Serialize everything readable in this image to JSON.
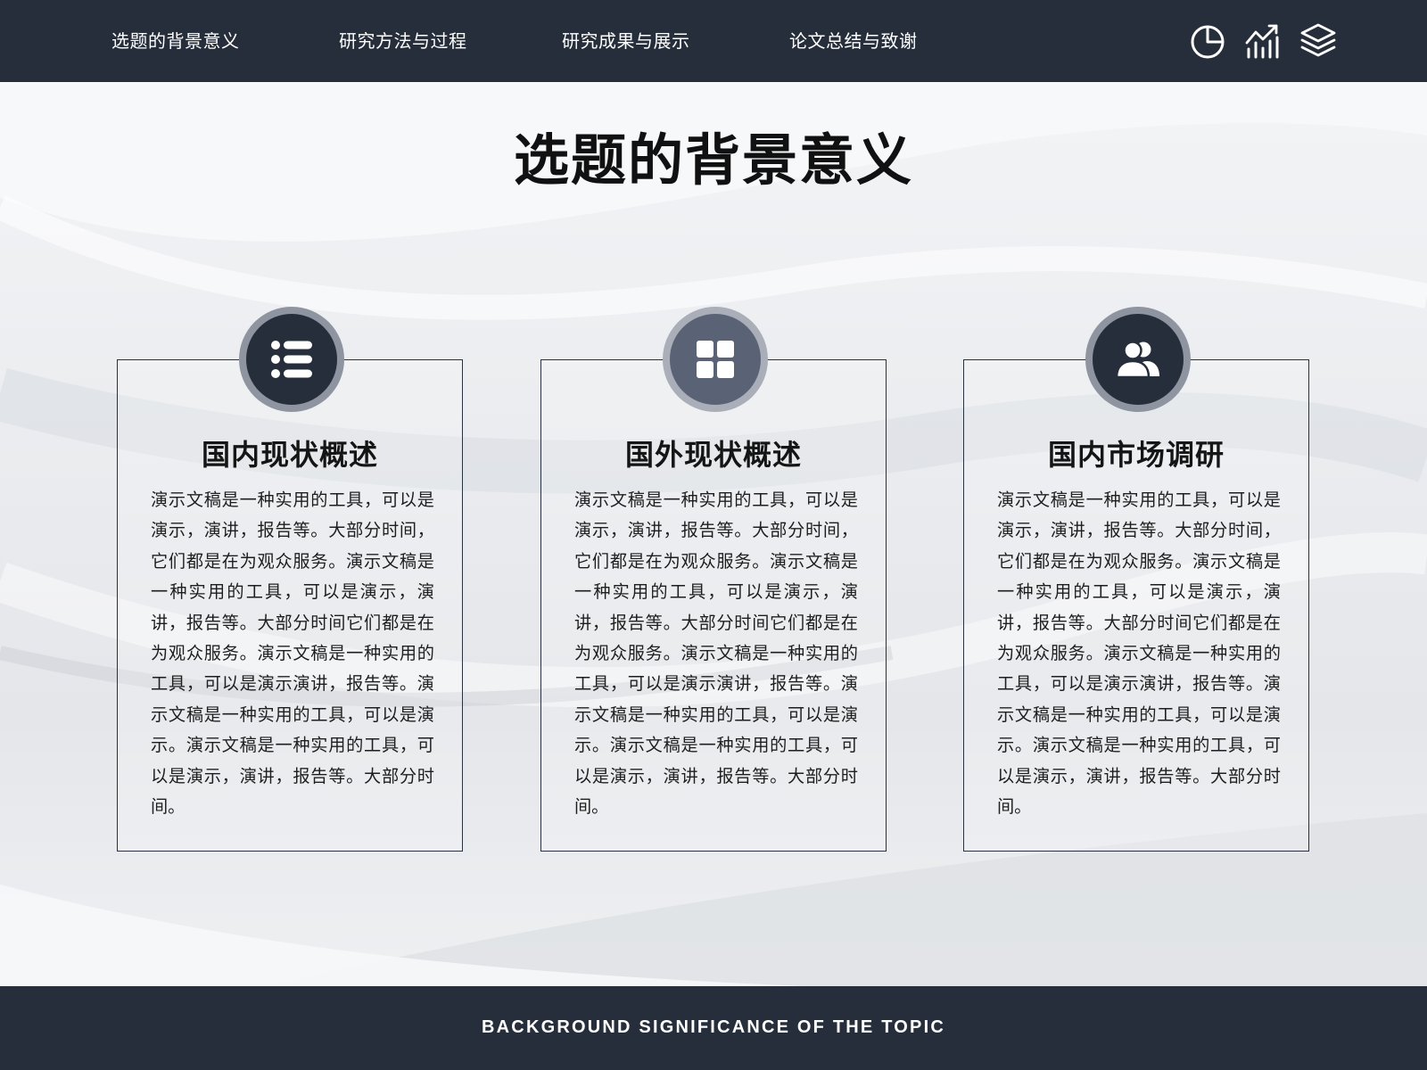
{
  "nav": {
    "items": [
      "选题的背景意义",
      "研究方法与过程",
      "研究成果与展示",
      "论文总结与致谢"
    ]
  },
  "toolbar_icons": [
    "pie-chart-icon",
    "trending-chart-icon",
    "layers-icon"
  ],
  "page": {
    "title": "选题的背景意义"
  },
  "cards": [
    {
      "icon": "list-icon",
      "title": "国内现状概述",
      "body": "演示文稿是一种实用的工具，可以是演示，演讲，报告等。大部分时间，它们都是在为观众服务。演示文稿是一种实用的工具，可以是演示，演讲，报告等。大部分时间它们都是在为观众服务。演示文稿是一种实用的工具，可以是演示演讲，报告等。演示文稿是一种实用的工具，可以是演示。演示文稿是一种实用的工具，可以是演示，演讲，报告等。大部分时间。"
    },
    {
      "icon": "grid-icon",
      "title": "国外现状概述",
      "body": "演示文稿是一种实用的工具，可以是演示，演讲，报告等。大部分时间，它们都是在为观众服务。演示文稿是一种实用的工具，可以是演示，演讲，报告等。大部分时间它们都是在为观众服务。演示文稿是一种实用的工具，可以是演示演讲，报告等。演示文稿是一种实用的工具，可以是演示。演示文稿是一种实用的工具，可以是演示，演讲，报告等。大部分时间。"
    },
    {
      "icon": "users-icon",
      "title": "国内市场调研",
      "body": "演示文稿是一种实用的工具，可以是演示，演讲，报告等。大部分时间，它们都是在为观众服务。演示文稿是一种实用的工具，可以是演示，演讲，报告等。大部分时间它们都是在为观众服务。演示文稿是一种实用的工具，可以是演示演讲，报告等。演示文稿是一种实用的工具，可以是演示。演示文稿是一种实用的工具，可以是演示，演讲，报告等。大部分时间。"
    }
  ],
  "footer": {
    "text": "BACKGROUND SIGNIFICANCE OF THE TOPIC"
  },
  "colors": {
    "bar": "#262e3b",
    "badge_ring": "#8e94a0",
    "badge_alt": "#5a6375"
  }
}
